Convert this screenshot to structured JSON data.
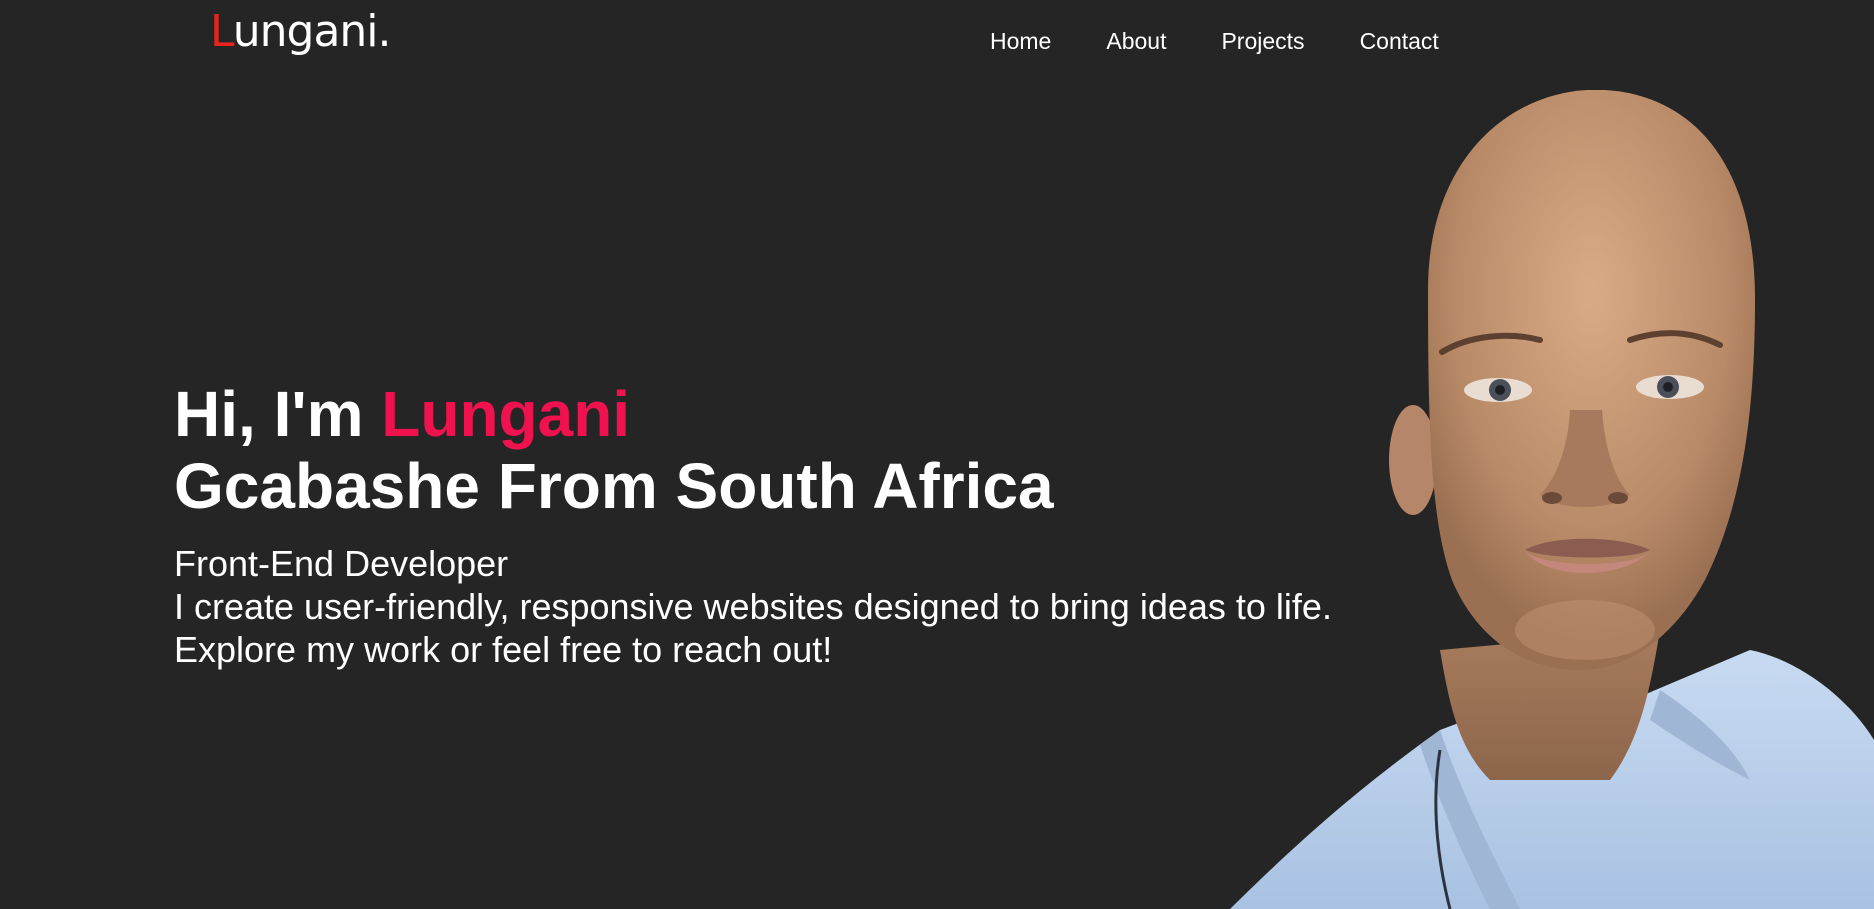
{
  "header": {
    "logo_initial": "L",
    "logo_rest": "ungani.",
    "nav": [
      {
        "label": "Home"
      },
      {
        "label": "About"
      },
      {
        "label": "Projects"
      },
      {
        "label": "Contact"
      }
    ]
  },
  "hero": {
    "greeting_prefix": "Hi, I'm ",
    "greeting_name": "Lungani",
    "greeting_line2": "Gcabashe From South Africa",
    "role": "Front-End Developer",
    "description_line1": "I create user-friendly, responsive websites designed to bring ideas to life.",
    "description_line2": "Explore my work or feel free to reach out!"
  },
  "colors": {
    "background": "#252525",
    "accent_logo": "#e8231f",
    "accent_name": "#f0124f",
    "text": "#ffffff"
  }
}
